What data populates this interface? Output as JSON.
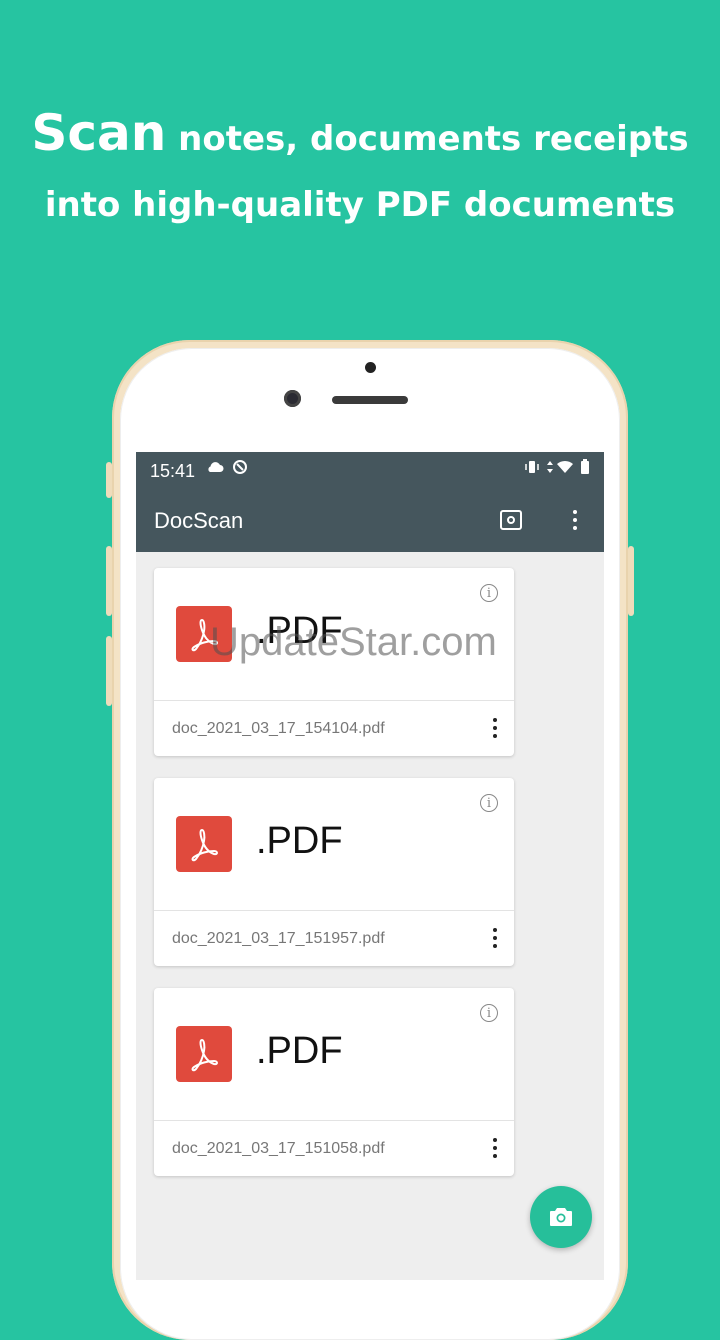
{
  "headline": {
    "word_big": "Scan",
    "line1_rest": " notes, documents receipts",
    "line2": "into high-quality PDF documents"
  },
  "statusbar": {
    "time": "15:41"
  },
  "appbar": {
    "title": "DocScan"
  },
  "documents": [
    {
      "ext": ".PDF",
      "filename": "doc_2021_03_17_154104.pdf"
    },
    {
      "ext": ".PDF",
      "filename": "doc_2021_03_17_151957.pdf"
    },
    {
      "ext": ".PDF",
      "filename": "doc_2021_03_17_151058.pdf"
    }
  ],
  "watermark": "UpdateStar.com",
  "colors": {
    "background": "#26c4a1",
    "appbar": "#45565d",
    "pdf_icon": "#e04a3d",
    "fab": "#26bf9a"
  },
  "icons": {
    "cloud": "cloud-icon",
    "sync": "sync-icon",
    "vibrate": "vibrate-icon",
    "data": "data-arrows-icon",
    "wifi": "wifi-icon",
    "battery": "battery-icon",
    "preview": "eye-icon",
    "more": "more-vert-icon",
    "info": "info-icon",
    "pdf": "pdf-file-icon",
    "camera": "camera-icon"
  }
}
